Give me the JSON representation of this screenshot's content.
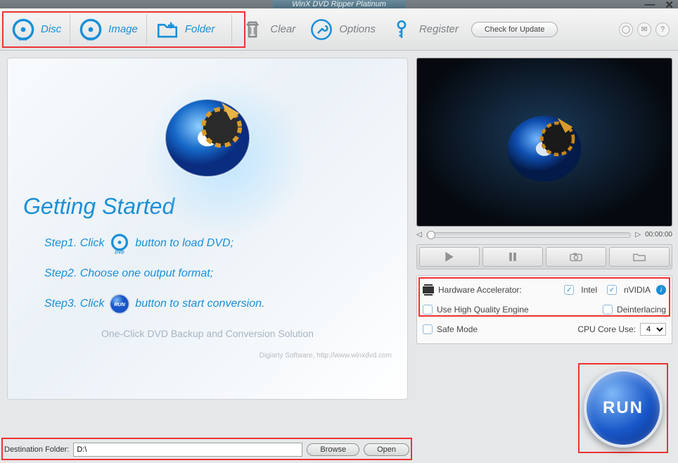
{
  "app": {
    "title": "WinX DVD Ripper Platinum"
  },
  "toolbar": {
    "disc": "Disc",
    "image": "Image",
    "folder": "Folder",
    "clear": "Clear",
    "options": "Options",
    "register": "Register",
    "update": "Check for Update"
  },
  "hero": {
    "heading": "Getting Started",
    "step1a": "Step1. Click",
    "step1b": "button to load DVD;",
    "step2": "Step2. Choose one output format;",
    "step3a": "Step3. Click",
    "step3b": "button to start conversion.",
    "slogan": "One-Click DVD Backup and Conversion Solution",
    "credit": "Digiarty Software, http://www.winxdvd.com"
  },
  "preview": {
    "time": "00:00:00"
  },
  "settings": {
    "hw_label": "Hardware Accelerator:",
    "intel": "Intel",
    "nvidia": "nVIDIA",
    "hq": "Use High Quality Engine",
    "deint": "Deinterlacing",
    "safe": "Safe Mode",
    "cpu_label": "CPU Core Use:",
    "cpu_value": "4"
  },
  "run": {
    "label": "RUN"
  },
  "dest": {
    "label": "Destination Folder:",
    "value": "D:\\",
    "browse": "Browse",
    "open": "Open"
  }
}
